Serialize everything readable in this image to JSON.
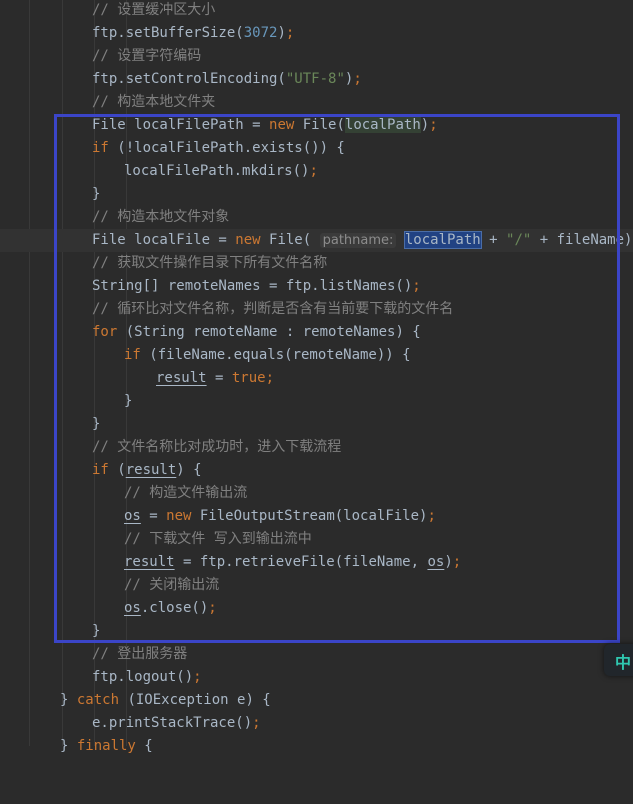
{
  "colors": {
    "background": "#2b2b2b",
    "keyword": "#cc7832",
    "comment": "#808080",
    "number": "#6897bb",
    "string": "#6a8759",
    "text": "#a9b7c6",
    "annotation_box": "#3b45c8",
    "ime_accent": "#2fc7b0"
  },
  "code": {
    "l1_comment": "// 设置缓冲区大小",
    "l2_a": "ftp.setBufferSize(",
    "l2_num": "3072",
    "l2_b": ")",
    "l3_comment": "// 设置字符编码",
    "l4_a": "ftp.setControlEncoding(",
    "l4_str": "\"UTF-8\"",
    "l4_b": ")",
    "l5_comment": "// 构造本地文件夹",
    "l6_a": "File localFilePath = ",
    "l6_kw": "new",
    "l6_b": " File(",
    "l6_var": "localPath",
    "l6_c": ")",
    "l7_kw": "if",
    "l7_a": " (!localFilePath.exists()) {",
    "l8_a": "localFilePath.mkdirs()",
    "l9_a": "}",
    "l10_comment": "// 构造本地文件对象",
    "l11_a": "File localFile = ",
    "l11_kw": "new",
    "l11_b": " File( ",
    "l11_hint": "pathname:",
    "l11_var": "localPath",
    "l11_c": " + ",
    "l11_str": "\"/\"",
    "l11_d": " + fileName)",
    "l12_comment": "// 获取文件操作目录下所有文件名称",
    "l13_a": "String[] remoteNames = ftp.listNames()",
    "l14_comment": "// 循环比对文件名称，判断是否含有当前要下载的文件名",
    "l15_kw": "for",
    "l15_a": " (String remoteName : remoteNames) {",
    "l16_kw": "if",
    "l16_a": " (fileName.equals(remoteName)) {",
    "l17_field": "result",
    "l17_a": " = ",
    "l17_kw": "true",
    "l18_a": "}",
    "l19_a": "}",
    "l20_comment": "// 文件名称比对成功时，进入下载流程",
    "l21_kw": "if",
    "l21_a": " (",
    "l21_field": "result",
    "l21_b": ") {",
    "l22_comment": "// 构造文件输出流",
    "l23_field": "os",
    "l23_a": " = ",
    "l23_kw": "new",
    "l23_b": " FileOutputStream(localFile)",
    "l24_comment": "// 下载文件 写入到输出流中",
    "l25_field": "result",
    "l25_a": " = ftp.retrieveFile(fileName, ",
    "l25_field2": "os",
    "l25_b": ")",
    "l26_comment": "// 关闭输出流",
    "l27_field": "os",
    "l27_a": ".close()",
    "l28_a": "}",
    "l29_comment": "// 登出服务器",
    "l30_a": "ftp.logout()",
    "l31_a": "} ",
    "l31_kw": "catch",
    "l31_b": " (IOException e) {",
    "l32_a": "e.printStackTrace()",
    "l33_a": "} ",
    "l33_kw": "finally",
    "l33_b": " {"
  },
  "punctuation": {
    "semicolon": ";",
    "comma": ","
  },
  "ime": {
    "label": "中"
  }
}
